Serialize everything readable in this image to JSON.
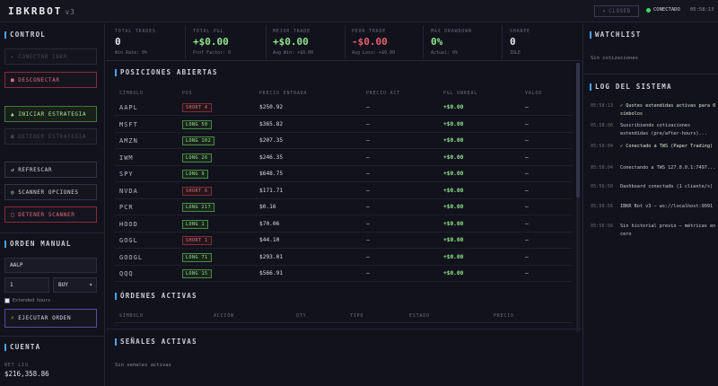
{
  "header": {
    "logo": "IBKRBOT",
    "version": "v3",
    "closed_button": "CLOSED",
    "connection": "CONECTADO",
    "clock": "05:58:13"
  },
  "left": {
    "control_title": "CONTROL",
    "connect_ibkr": "CONECTAR IBKR",
    "disconnect": "DESCONECTAR",
    "start_strategy": "INICIAR ESTRATEGIA",
    "stop_strategy": "DETENER ESTRATEGIA",
    "refresh": "REFRESCAR",
    "scanner_options": "SCANNER OPCIONES",
    "stop_scanner": "DETENER SCANNER",
    "manual_order_title": "ORDEN MANUAL",
    "symbol_value": "AALP",
    "qty_value": "1",
    "side_value": "BUY",
    "extended_hours": "Extended hours",
    "execute_order": "EJECUTAR ORDEN",
    "account_title": "CUENTA",
    "net_liq_label": "NET LIQ",
    "net_liq_value": "$216,358.86"
  },
  "metrics": [
    {
      "label": "TOTAL TRADES",
      "value": "0",
      "sub": "Win Rate: 0%"
    },
    {
      "label": "TOTAL P&L",
      "value": "+$0.00",
      "sub": "Prof Factor: 0",
      "color": "green"
    },
    {
      "label": "MEJOR TRADE",
      "value": "+$0.00",
      "sub": "Avg Win: +$0.00",
      "color": "green"
    },
    {
      "label": "PEOR TRADE",
      "value": "-$0.00",
      "sub": "Avg Loss: +$0.00",
      "color": "red"
    },
    {
      "label": "MAX DRAWDOWN",
      "value": "0%",
      "sub": "Actual: 0%",
      "color": "green"
    },
    {
      "label": "SHARPE",
      "value": "0",
      "sub": "IDLE"
    }
  ],
  "positions": {
    "title": "POSICIONES ABIERTAS",
    "headers": [
      "SÍMBOLO",
      "POS",
      "PRECIO ENTRADA",
      "PRECIO ACT",
      "P&L UNREAL",
      "VALOR"
    ],
    "rows": [
      {
        "symbol": "AAPL",
        "pos": "SHORT 4",
        "side": "short",
        "entry": "$250.92",
        "price": "—",
        "pnl": "+$0.00",
        "value": "—"
      },
      {
        "symbol": "MSFT",
        "pos": "LONG 50",
        "side": "long",
        "entry": "$365.82",
        "price": "—",
        "pnl": "+$0.00",
        "value": "—"
      },
      {
        "symbol": "AMZN",
        "pos": "LONG 102",
        "side": "long",
        "entry": "$207.35",
        "price": "—",
        "pnl": "+$0.00",
        "value": "—"
      },
      {
        "symbol": "IWM",
        "pos": "LONG 26",
        "side": "long",
        "entry": "$246.35",
        "price": "—",
        "pnl": "+$0.00",
        "value": "—"
      },
      {
        "symbol": "SPY",
        "pos": "LONG 9",
        "side": "long",
        "entry": "$648.75",
        "price": "—",
        "pnl": "+$0.00",
        "value": "—"
      },
      {
        "symbol": "NVDA",
        "pos": "SHORT 6",
        "side": "short",
        "entry": "$171.71",
        "price": "—",
        "pnl": "+$0.00",
        "value": "—"
      },
      {
        "symbol": "PCR",
        "pos": "LONG 217",
        "side": "long",
        "entry": "$0.16",
        "price": "—",
        "pnl": "+$0.00",
        "value": "—"
      },
      {
        "symbol": "HOOD",
        "pos": "LONG 1",
        "side": "long",
        "entry": "$70.06",
        "price": "—",
        "pnl": "+$0.00",
        "value": "—"
      },
      {
        "symbol": "GOGL",
        "pos": "SHORT 1",
        "side": "short",
        "entry": "$44.10",
        "price": "—",
        "pnl": "+$0.00",
        "value": "—"
      },
      {
        "symbol": "GOOGL",
        "pos": "LONG 71",
        "side": "long",
        "entry": "$293.01",
        "price": "—",
        "pnl": "+$0.00",
        "value": "—"
      },
      {
        "symbol": "QQQ",
        "pos": "LONG 15",
        "side": "long",
        "entry": "$566.91",
        "price": "—",
        "pnl": "+$0.00",
        "value": "—"
      }
    ]
  },
  "orders": {
    "title": "ÓRDENES ACTIVAS",
    "headers": [
      "SÍMBOLO",
      "ACCIÓN",
      "QTY",
      "TIPO",
      "ESTADO",
      "PRECIO"
    ]
  },
  "signals": {
    "title": "SEÑALES ACTIVAS",
    "empty": "Sin señales activas"
  },
  "watchlist": {
    "title": "WATCHLIST",
    "empty": "Sin cotizaciones"
  },
  "log": {
    "title": "LOG DEL SISTEMA",
    "entries": [
      {
        "time": "05:58:13",
        "msg": "✓ Quotes extendidas activas para 0 símbolos",
        "ok": true
      },
      {
        "time": "05:58:06",
        "msg": "Suscribiendo cotizaciones extendidas (pre/after-hours)...",
        "ok": false
      },
      {
        "time": "05:58:04",
        "msg": "✓ Conectado a TWS (Paper Trading)",
        "ok": true
      },
      {
        "time": "05:58:04",
        "msg": "Conectando a TWS 127.0.0.1:7497...",
        "ok": false
      },
      {
        "time": "05:56:58",
        "msg": "Dashboard conectado (1 cliente/s)",
        "ok": false
      },
      {
        "time": "05:56:56",
        "msg": "IBKR Bot v3 — ws://localhost:9991",
        "ok": false
      },
      {
        "time": "05:56:56",
        "msg": "Sin historial previo — métricas en cero",
        "ok": false
      }
    ]
  },
  "colors": {
    "accent": "#4aa3ff",
    "green": "#8ee68a",
    "red": "#e8606e",
    "background": "#12121c"
  }
}
